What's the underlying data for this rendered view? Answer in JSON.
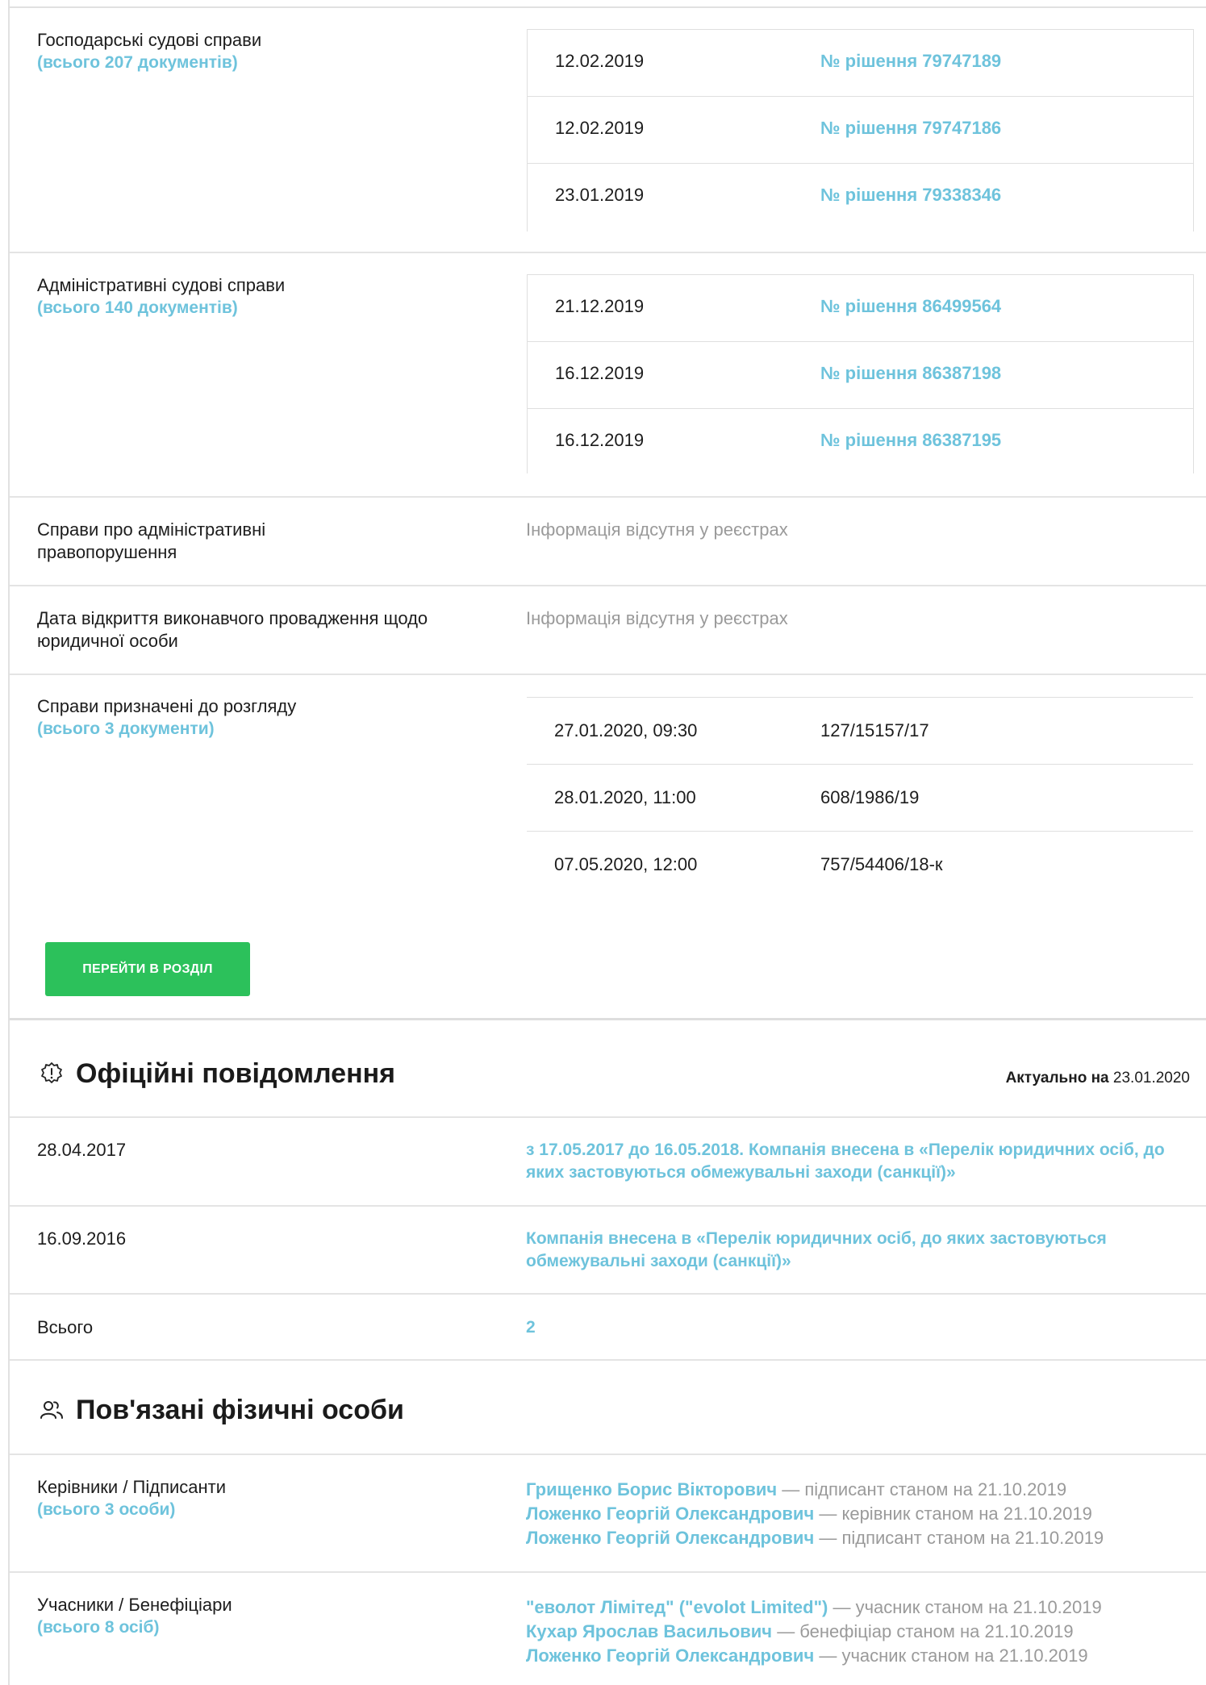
{
  "commercial_cases": {
    "label": "Господарські судові справи",
    "count": "(всього 207 документів)",
    "rows": [
      {
        "date": "12.02.2019",
        "decision": "№ рішення 79747189"
      },
      {
        "date": "12.02.2019",
        "decision": "№ рішення 79747186"
      },
      {
        "date": "23.01.2019",
        "decision": "№ рішення 79338346"
      }
    ]
  },
  "administrative_cases": {
    "label": "Адміністративні судові справи",
    "count": "(всього 140 документів)",
    "rows": [
      {
        "date": "21.12.2019",
        "decision": "№ рішення 86499564"
      },
      {
        "date": "16.12.2019",
        "decision": "№ рішення 86387198"
      },
      {
        "date": "16.12.2019",
        "decision": "№ рішення 86387195"
      }
    ]
  },
  "admin_offenses": {
    "label": "Справи про адміністративні правопорушення",
    "value": "Інформація відсутня у реєстрах"
  },
  "enforcement": {
    "label": "Дата відкриття виконавчого провадження щодо юридичної особи",
    "value": "Інформація відсутня у реєстрах"
  },
  "scheduled_cases": {
    "label": "Справи призначені до розгляду",
    "count": "(всього 3 документи)",
    "rows": [
      {
        "datetime": "27.01.2020, 09:30",
        "case": "127/15157/17"
      },
      {
        "datetime": "28.01.2020, 11:00",
        "case": "608/1986/19"
      },
      {
        "datetime": "07.05.2020, 12:00",
        "case": "757/54406/18-к"
      }
    ],
    "button": "ПЕРЕЙТИ В РОЗДІЛ"
  },
  "official_notices": {
    "title": "Офіційні повідомлення",
    "icon": "warning-badge-icon",
    "actual_label": "Актуально на",
    "actual_date": "23.01.2020",
    "items": [
      {
        "date": "28.04.2017",
        "text": "з 17.05.2017 до 16.05.2018. Компанія внесена в «Перелік юридичних осіб, до яких застовуються обмежувальні заходи (санкції)»"
      },
      {
        "date": "16.09.2016",
        "text": "Компанія внесена в «Перелік юридичних осіб, до яких застовуються обмежувальні заходи (санкції)»"
      }
    ],
    "total_label": "Всього",
    "total_value": "2"
  },
  "related_persons": {
    "title": "Пов'язані фізичні особи",
    "icon": "people-icon",
    "managers": {
      "label": "Керівники / Підписанти",
      "count": "(всього 3 особи)",
      "people": [
        {
          "name": "Грищенко Борис Вікторович",
          "role": " — підписант станом на 21.10.2019"
        },
        {
          "name": "Ложенко Георгій Олександрович",
          "role": " — керівник станом на 21.10.2019"
        },
        {
          "name": "Ложенко Георгій Олександрович",
          "role": " — підписант станом на 21.10.2019"
        }
      ]
    },
    "participants": {
      "label": "Учасники / Бенефіціари",
      "count": "(всього 8 осіб)",
      "people": [
        {
          "name": "\"еволот Лімітед\" (\"evolot Limited\")",
          "role": " — учасник станом на 21.10.2019"
        },
        {
          "name": "Кухар Ярослав Васильович",
          "role": " — бенефіціар станом на 21.10.2019"
        },
        {
          "name": "Ложенко Георгій Олександрович",
          "role": " — учасник станом на 21.10.2019"
        }
      ]
    }
  },
  "colors": {
    "link": "#6ec3dc",
    "button": "#2cc15b",
    "muted": "#9a9a9a"
  }
}
